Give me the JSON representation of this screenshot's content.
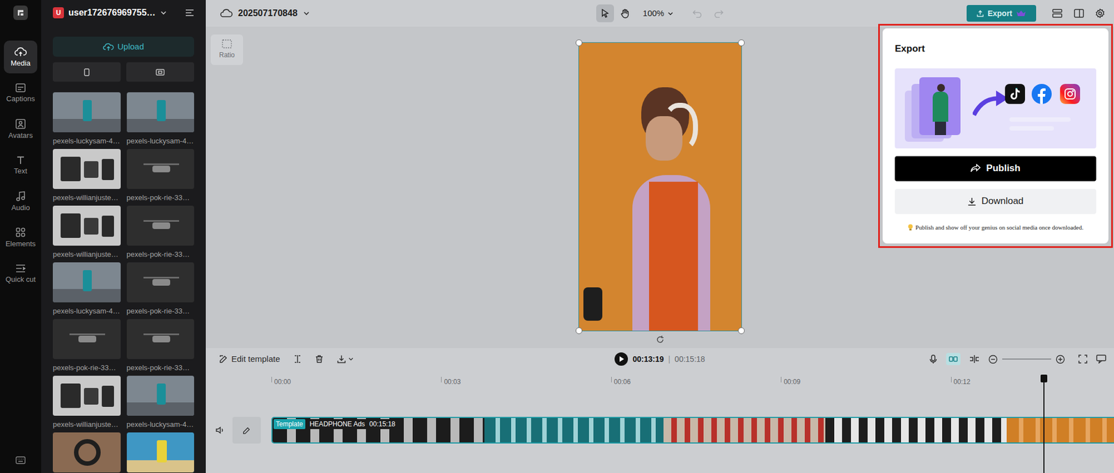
{
  "account": {
    "initial": "U",
    "name": "user172676969755…"
  },
  "rail": {
    "items": [
      {
        "label": "Media",
        "selected": true
      },
      {
        "label": "Captions",
        "selected": false
      },
      {
        "label": "Avatars",
        "selected": false
      },
      {
        "label": "Text",
        "selected": false
      },
      {
        "label": "Audio",
        "selected": false
      },
      {
        "label": "Elements",
        "selected": false
      },
      {
        "label": "Quick cut",
        "selected": false
      }
    ]
  },
  "media": {
    "upload": "Upload",
    "thumbnails": [
      {
        "label": "pexels-luckysam-4…",
        "kind": "phone"
      },
      {
        "label": "pexels-luckysam-4…",
        "kind": "phone"
      },
      {
        "label": "pexels-willianjuste…",
        "kind": "devices"
      },
      {
        "label": "pexels-pok-rie-33…",
        "kind": "drone"
      },
      {
        "label": "pexels-willianjuste…",
        "kind": "devices"
      },
      {
        "label": "pexels-pok-rie-33…",
        "kind": "drone"
      },
      {
        "label": "pexels-luckysam-4…",
        "kind": "phone"
      },
      {
        "label": "pexels-pok-rie-33…",
        "kind": "drone"
      },
      {
        "label": "pexels-pok-rie-33…",
        "kind": "drone"
      },
      {
        "label": "pexels-pok-rie-33…",
        "kind": "drone"
      },
      {
        "label": "pexels-willianjuste…",
        "kind": "devices"
      },
      {
        "label": "pexels-luckysam-4…",
        "kind": "phone"
      },
      {
        "kind": "headphones"
      },
      {
        "kind": "beach"
      }
    ]
  },
  "project": {
    "title": "202507170848"
  },
  "toolbar": {
    "tools": [
      {
        "kind": "select",
        "selected": true
      },
      {
        "kind": "hand",
        "selected": false
      }
    ],
    "zoom": "100%",
    "undo": {
      "disabled": true
    },
    "redo": {
      "disabled": true
    },
    "export": "Export"
  },
  "canvas": {
    "ratio": "Ratio"
  },
  "timeline": {
    "edit_template": "Edit template",
    "current_time": "00:13:19",
    "separator": "|",
    "total_time": "00:15:18",
    "snap": {
      "on": true
    },
    "ruler": [
      "00:00",
      "00:03",
      "00:06",
      "00:09",
      "00:12"
    ],
    "playhead_level": 0.874,
    "track": {
      "badge": "Template",
      "name": "HEADPHONE Ads",
      "duration": "00:15:18"
    }
  },
  "export_popup": {
    "title": "Export",
    "publish": "Publish",
    "download": "Download",
    "tip": "Publish and show off your genius on social media once downloaded."
  }
}
